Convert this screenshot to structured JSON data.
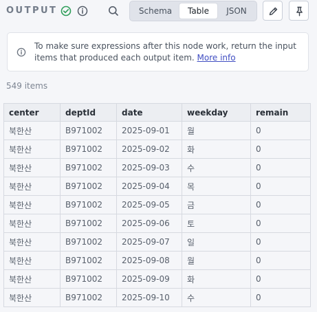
{
  "output": {
    "title": "OUTPUT",
    "success_color": "#2f9e5a",
    "tabs": [
      {
        "label": "Schema",
        "active": false
      },
      {
        "label": "Table",
        "active": true
      },
      {
        "label": "JSON",
        "active": false
      }
    ],
    "notice": {
      "text": "To make sure expressions after this node work, return the input items that produced each output item.",
      "link": "More info"
    },
    "item_count": "549 items"
  },
  "table": {
    "columns": [
      "center",
      "deptId",
      "date",
      "weekday",
      "remain"
    ],
    "rows": [
      [
        "북한산",
        "B971002",
        "2025-09-01",
        "월",
        "0"
      ],
      [
        "북한산",
        "B971002",
        "2025-09-02",
        "화",
        "0"
      ],
      [
        "북한산",
        "B971002",
        "2025-09-03",
        "수",
        "0"
      ],
      [
        "북한산",
        "B971002",
        "2025-09-04",
        "목",
        "0"
      ],
      [
        "북한산",
        "B971002",
        "2025-09-05",
        "금",
        "0"
      ],
      [
        "북한산",
        "B971002",
        "2025-09-06",
        "토",
        "0"
      ],
      [
        "북한산",
        "B971002",
        "2025-09-07",
        "일",
        "0"
      ],
      [
        "북한산",
        "B971002",
        "2025-09-08",
        "월",
        "0"
      ],
      [
        "북한산",
        "B971002",
        "2025-09-09",
        "화",
        "0"
      ],
      [
        "북한산",
        "B971002",
        "2025-09-10",
        "수",
        "0"
      ]
    ]
  }
}
